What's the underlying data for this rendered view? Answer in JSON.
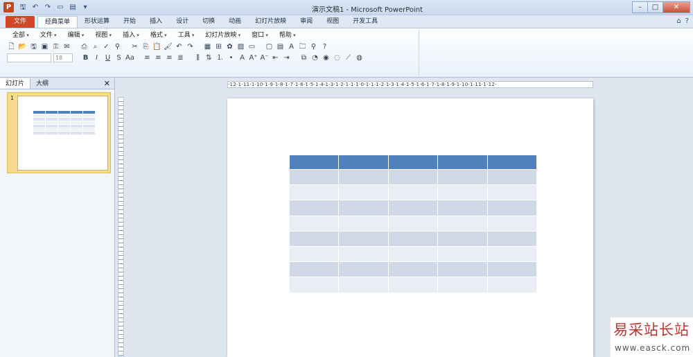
{
  "window": {
    "title": "演示文稿1 - Microsoft PowerPoint",
    "app_icon_letter": "P",
    "quick_access": [
      "save-icon",
      "undo-icon",
      "redo-icon",
      "new-slide-icon",
      "layout-icon",
      "customize-icon"
    ],
    "controls": [
      "–",
      "□",
      "✕"
    ]
  },
  "ribbon_tabs": [
    "文件",
    "经典菜单",
    "形状运算",
    "开始",
    "插入",
    "设计",
    "切换",
    "动画",
    "幻灯片放映",
    "审阅",
    "视图",
    "开发工具"
  ],
  "active_tab": "经典菜单",
  "classic_menus": [
    "全部",
    "文件",
    "编辑",
    "视图",
    "插入",
    "格式",
    "工具",
    "幻灯片放映",
    "窗口",
    "帮助"
  ],
  "font_size_value": "18",
  "left_panel": {
    "tabs": [
      "幻灯片",
      "大纲"
    ],
    "active_tab": "幻灯片",
    "close_glyph": "✕",
    "slide_number": "1"
  },
  "ruler_text": "·12·1·11·1·10·1·9·1·8·1·7·1·6·1·5·1·4·1·3·1·2·1·1·1·0·1·1·1·2·1·3·1·4·1·5·1·6·1·7·1·8·1·9·1·10·1·11·1·12·",
  "slide_table": {
    "columns": 5,
    "body_rows": 8,
    "header_color": "#4f81bd",
    "band_color_1": "#d0d8e8",
    "band_color_2": "#e9edf4"
  },
  "watermark": {
    "logo_text": "易采站长站",
    "url": "www.easck.com"
  },
  "colors": {
    "file_tab": "#d24726",
    "thumbnail_selected": "#f6dc8e",
    "accent": "#4f81bd"
  }
}
